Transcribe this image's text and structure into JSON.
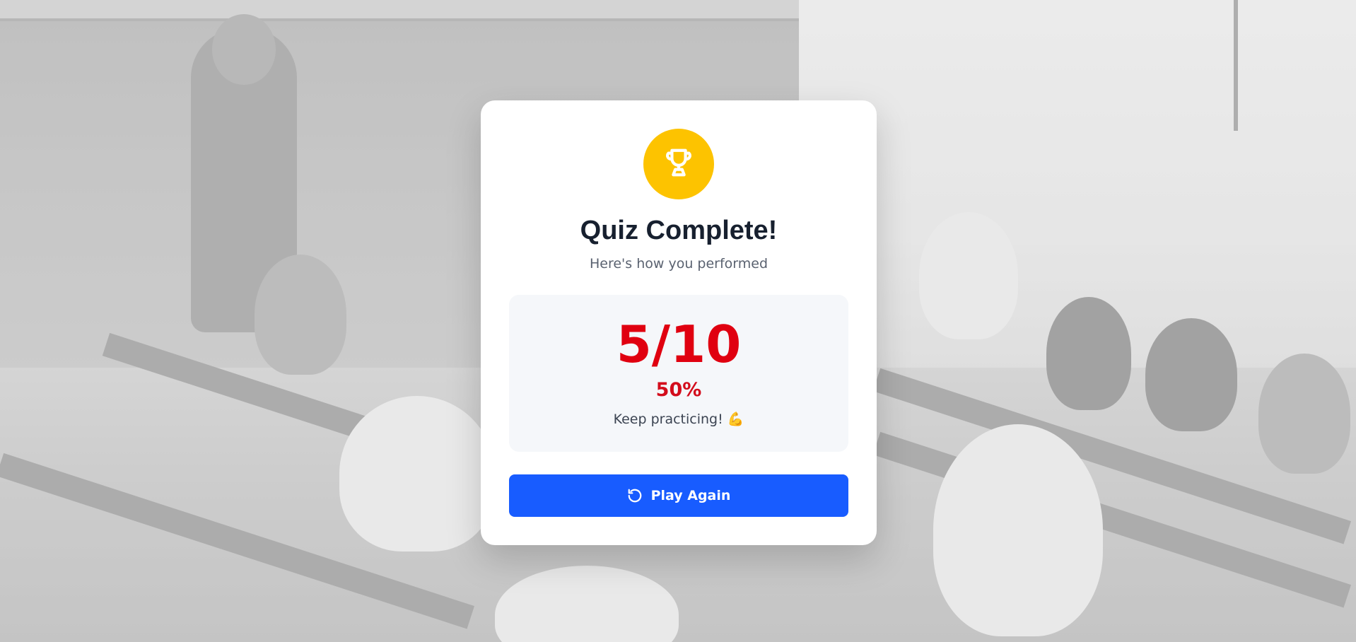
{
  "result": {
    "title": "Quiz Complete!",
    "subtitle": "Here's how you performed",
    "score_text": "5/10",
    "percent_text": "50%",
    "message": "Keep practicing! 💪",
    "progress_fraction": 0.5
  },
  "actions": {
    "play_again_label": "Play Again"
  },
  "icons": {
    "trophy": "trophy-icon",
    "restart": "rotate-ccw-icon"
  },
  "colors": {
    "trophy_bg": "#fdc300",
    "score_red": "#e00010",
    "button_blue": "#185cff",
    "title_dark": "#17202f"
  }
}
